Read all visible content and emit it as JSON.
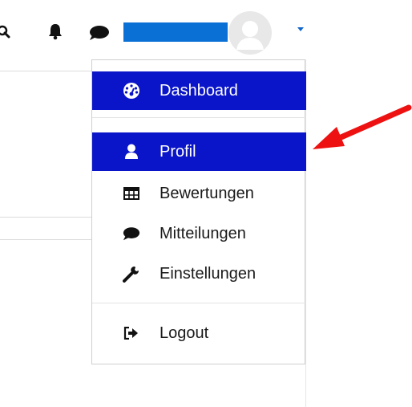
{
  "menu": {
    "items": [
      {
        "label": "Dashboard",
        "icon": "dashboard-icon"
      },
      {
        "label": "Profil",
        "icon": "user-icon"
      },
      {
        "label": "Bewertungen",
        "icon": "table-icon"
      },
      {
        "label": "Mitteilungen",
        "icon": "speech-bubble-icon"
      },
      {
        "label": "Einstellungen",
        "icon": "wrench-icon"
      },
      {
        "label": "Logout",
        "icon": "logout-icon"
      }
    ]
  },
  "colors": {
    "highlight": "#0a14c8",
    "username_redaction": "#0a70d6",
    "annotation_arrow": "#ee1111"
  }
}
